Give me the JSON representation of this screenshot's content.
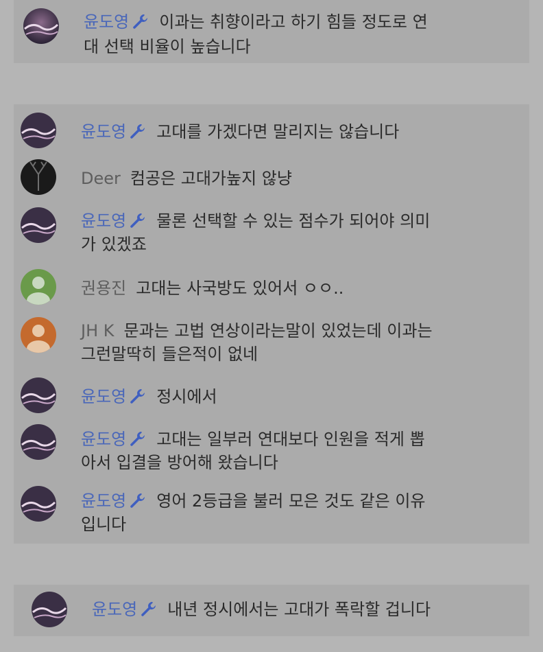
{
  "colors": {
    "background": "#b5b5b5",
    "block": "#ababab",
    "owner_name": "#4a67b9",
    "other_name": "#5e5e5e",
    "message_text": "#2a2a2a"
  },
  "messages": [
    {
      "author": "윤도영",
      "owner": true,
      "lines": [
        "이과는 취향이라고 하기 힘들 정도로 연",
        "대 선택 비율이 높습니다"
      ]
    },
    {
      "author": "윤도영",
      "owner": true,
      "lines": [
        "고대를 가겠다면 말리지는 않습니다"
      ]
    },
    {
      "author": "Deer",
      "owner": false,
      "lines": [
        "컴공은 고대가높지 않냥"
      ]
    },
    {
      "author": "윤도영",
      "owner": true,
      "lines": [
        "물론 선택할 수 있는 점수가 되어야 의미",
        "가 있겠죠"
      ]
    },
    {
      "author": "권용진",
      "owner": false,
      "lines": [
        "고대는 사국방도 있어서 ㅇㅇ.."
      ]
    },
    {
      "author": "JH K",
      "owner": false,
      "lines": [
        "문과는 고법 연상이라는말이 있었는데 이과는",
        "그런말딱히 들은적이 없네"
      ]
    },
    {
      "author": "윤도영",
      "owner": true,
      "lines": [
        "정시에서"
      ]
    },
    {
      "author": "윤도영",
      "owner": true,
      "lines": [
        "고대는 일부러 연대보다 인원을 적게 뽑",
        "아서 입결을 방어해 왔습니다"
      ]
    },
    {
      "author": "윤도영",
      "owner": true,
      "lines": [
        "영어 2등급을 불러 모은 것도 같은 이유",
        "입니다"
      ]
    },
    {
      "author": "윤도영",
      "owner": true,
      "lines": [
        "내년 정시에서는 고대가 폭락할 겁니다"
      ]
    }
  ]
}
